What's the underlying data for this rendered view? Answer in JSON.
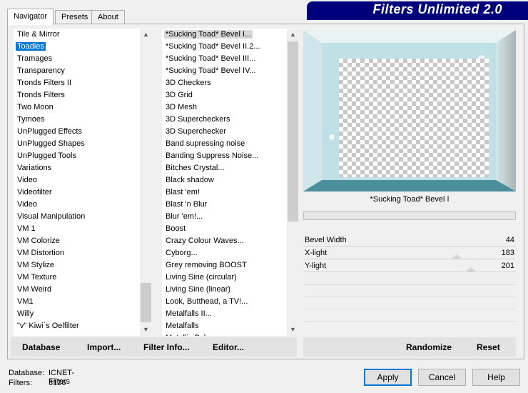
{
  "tabs": [
    "Navigator",
    "Presets",
    "About"
  ],
  "banner_title": "Filters Unlimited 2.0",
  "categories": [
    "Tile & Mirror",
    "Toadies",
    "Tramages",
    "Transparency",
    "Tronds Filters II",
    "Tronds Filters",
    "Two Moon",
    "Tymoes",
    "UnPlugged Effects",
    "UnPlugged Shapes",
    "UnPlugged Tools",
    "Variations",
    "Video",
    "Videofilter",
    "Video",
    "Visual Manipulation",
    "VM 1",
    "VM Colorize",
    "VM Distortion",
    "VM Stylize",
    "VM Texture",
    "VM Weird",
    "VM1",
    "Willy",
    "\"v\" Kiwi`s Oelfilter"
  ],
  "selected_category": "Toadies",
  "filters": [
    "*Sucking Toad*  Bevel I...",
    "*Sucking Toad*  Bevel II.2...",
    "*Sucking Toad*  Bevel III...",
    "*Sucking Toad*  Bevel IV...",
    "3D Checkers",
    "3D Grid",
    "3D Mesh",
    "3D Supercheckers",
    "3D Superchecker",
    "Band supressing noise",
    "Banding Suppress Noise...",
    "Bitches Crystal...",
    "Black shadow",
    "Blast 'em!",
    "Blast 'n Blur",
    "Blur 'em!...",
    "Boost",
    "Crazy Colour Waves...",
    "Cyborg...",
    "Grey removing BOOST",
    "Living Sine (circular)",
    "Living Sine (linear)",
    "Look, Butthead, a TV!...",
    "Metalfalls II...",
    "Metalfalls",
    "Metallic Puke..."
  ],
  "selected_filter": "*Sucking Toad*  Bevel I...",
  "current_filter_name": "*Sucking Toad*  Bevel I",
  "params": [
    {
      "label": "Bevel Width",
      "value": "44"
    },
    {
      "label": "X-light",
      "value": "183"
    },
    {
      "label": "Y-light",
      "value": "201"
    }
  ],
  "left_buttons": [
    "Database",
    "Import...",
    "Filter Info...",
    "Editor..."
  ],
  "right_buttons": [
    "Randomize",
    "Reset"
  ],
  "status": {
    "database_label": "Database:",
    "database_value": "ICNET-Filters",
    "filters_label": "Filters:",
    "filters_value": "3126"
  },
  "dialog_buttons": {
    "apply": "Apply",
    "cancel": "Cancel",
    "help": "Help"
  },
  "colors": {
    "banner": "#00007b",
    "selection": "#0078d7"
  }
}
